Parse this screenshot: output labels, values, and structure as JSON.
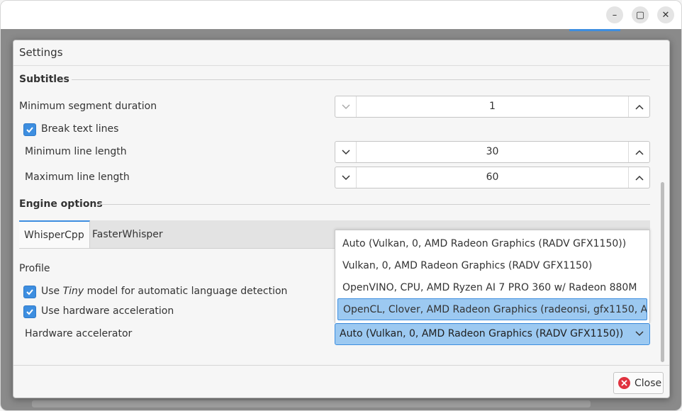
{
  "main_window": {
    "minimize_glyph": "–",
    "maximize_glyph": "▢",
    "close_glyph": "✕"
  },
  "dialog": {
    "title": "Settings",
    "subtitles": {
      "heading": "Subtitles",
      "min_segment_label": "Minimum segment duration",
      "min_segment_value": "1",
      "break_lines_label": "Break text lines",
      "break_lines_checked": true,
      "min_line_label": "Minimum line length",
      "min_line_value": "30",
      "max_line_label": "Maximum line length",
      "max_line_value": "60"
    },
    "engine": {
      "heading": "Engine options",
      "tabs": [
        {
          "label": "WhisperCpp",
          "active": true
        },
        {
          "label": "FasterWhisper",
          "active": false
        }
      ],
      "profile_label": "Profile",
      "tiny_model_prefix": "Use ",
      "tiny_model_emph": "Tiny",
      "tiny_model_suffix": " model for automatic language detection",
      "tiny_model_checked": true,
      "hw_accel_label": "Use hardware acceleration",
      "hw_accel_checked": true,
      "accelerator_label": "Hardware accelerator",
      "accelerator_selected": "Auto (Vulkan, 0, AMD Radeon Graphics (RADV GFX1150))",
      "accelerator_options": [
        "Auto (Vulkan, 0, AMD Radeon Graphics (RADV GFX1150))",
        "Vulkan, 0, AMD Radeon Graphics (RADV GFX1150)",
        "OpenVINO, CPU, AMD Ryzen AI 7 PRO 360 w/ Radeon 880M",
        "OpenCL, Clover, AMD Radeon Graphics (radeonsi, gfx1150, A…"
      ],
      "highlighted_option_index": 3
    },
    "close_label": "Close"
  },
  "colors": {
    "accent": "#3d8ee0",
    "selection": "#9cc9f1",
    "close_icon": "#e03340"
  }
}
